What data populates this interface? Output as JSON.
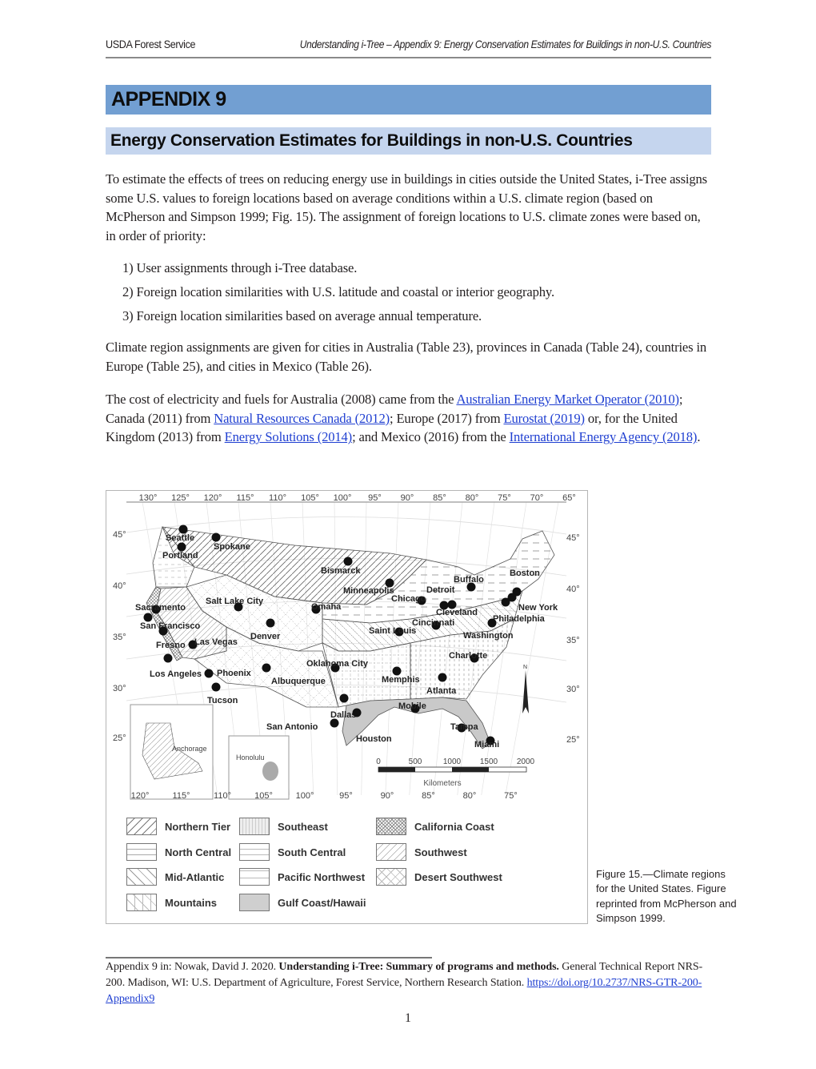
{
  "header": {
    "left": "USDA Forest Service",
    "right": "Understanding i-Tree – Appendix 9: Energy Conservation Estimates for Buildings in non-U.S. Countries"
  },
  "title": "APPENDIX 9",
  "subtitle": "Energy Conservation Estimates for Buildings in non-U.S. Countries",
  "intro_paragraph": "To estimate the effects of trees on reducing energy use in buildings in cities outside the United States, i-Tree assigns some U.S. values to foreign locations based on average conditions within a U.S. climate region (based on McPherson and Simpson 1999; Fig. 15). The assignment of foreign locations to U.S. climate zones were based on, in order of priority:",
  "priority_list": [
    "1) User assignments through i-Tree database.",
    "2) Foreign location similarities with U.S. latitude and coastal or interior geography.",
    "3) Foreign location similarities based on average annual temperature."
  ],
  "assignments_paragraph": "Climate region assignments are given for cities in Australia (Table 23), provinces in Canada (Table 24), countries in Europe (Table 25), and cities in Mexico (Table 26).",
  "cost_paragraph": {
    "t1": "The cost of electricity and fuels for Australia (2008) came from the ",
    "link1": "Australian Energy Market Operator (2010)",
    "t2": "; Canada (2011) from ",
    "link2": "Natural Resources Canada (2012)",
    "t3": "; Europe (2017) from ",
    "link3": "Eurostat (2019)",
    "t4": " or, for the United Kingdom (2013) from ",
    "link4": "Energy Solutions (2014)",
    "t5": "; and Mexico (2016) from the ",
    "link5": "International Energy Agency (2018)",
    "t6": "."
  },
  "figure": {
    "top_longitudes": [
      "130°",
      "125°",
      "120°",
      "115°",
      "110°",
      "105°",
      "100°",
      "95°",
      "90°",
      "85°",
      "80°",
      "75°",
      "70°",
      "65°"
    ],
    "bottom_longitudes": [
      "120°",
      "115°",
      "110°",
      "105°",
      "100°",
      "95°",
      "90°",
      "85°",
      "80°",
      "75°"
    ],
    "left_latitudes": [
      "45°",
      "40°",
      "35°",
      "30°",
      "25°"
    ],
    "right_latitudes": [
      "45°",
      "40°",
      "35°",
      "30°",
      "25°"
    ],
    "cities": [
      {
        "name": "Seattle"
      },
      {
        "name": "Spokane"
      },
      {
        "name": "Portland"
      },
      {
        "name": "Bismarck"
      },
      {
        "name": "Minneapolis"
      },
      {
        "name": "Buffalo"
      },
      {
        "name": "Boston"
      },
      {
        "name": "Detroit"
      },
      {
        "name": "Chicago"
      },
      {
        "name": "Sacramento"
      },
      {
        "name": "Salt Lake City"
      },
      {
        "name": "Omaha"
      },
      {
        "name": "Cleveland"
      },
      {
        "name": "New York"
      },
      {
        "name": "Philadelphia"
      },
      {
        "name": "San Francisco"
      },
      {
        "name": "Cincinnati"
      },
      {
        "name": "Saint Louis"
      },
      {
        "name": "Washington"
      },
      {
        "name": "Fresno"
      },
      {
        "name": "Las Vegas"
      },
      {
        "name": "Denver"
      },
      {
        "name": "Charlotte"
      },
      {
        "name": "Oklahoma City"
      },
      {
        "name": "Los Angeles"
      },
      {
        "name": "Phoenix"
      },
      {
        "name": "Albuquerque"
      },
      {
        "name": "Memphis"
      },
      {
        "name": "Atlanta"
      },
      {
        "name": "Tucson"
      },
      {
        "name": "Dallas"
      },
      {
        "name": "Mobile"
      },
      {
        "name": "San Antonio"
      },
      {
        "name": "Houston"
      },
      {
        "name": "Tampa"
      },
      {
        "name": "Miami"
      }
    ],
    "insets": {
      "alaska": "Anchorage",
      "hawaii": "Honolulu"
    },
    "scale_bar": {
      "ticks": [
        "0",
        "500",
        "1000",
        "1500",
        "2000"
      ],
      "unit": "Kilometers"
    },
    "north_label": "N",
    "legend": [
      {
        "label": "Northern Tier",
        "pattern": "diagonal-right"
      },
      {
        "label": "Southeast",
        "pattern": "dots-vertical"
      },
      {
        "label": "California Coast",
        "pattern": "crosshatch"
      },
      {
        "label": "North Central",
        "pattern": "dash-horizontal"
      },
      {
        "label": "South Central",
        "pattern": "grid-dashed"
      },
      {
        "label": "Southwest",
        "pattern": "diagonal-light"
      },
      {
        "label": "Mid-Atlantic",
        "pattern": "diagonal-left"
      },
      {
        "label": "Pacific Northwest",
        "pattern": "dash-fine"
      },
      {
        "label": "Desert Southwest",
        "pattern": "x-dashed"
      },
      {
        "label": "Mountains",
        "pattern": "star-dashed"
      },
      {
        "label": "Gulf Coast/Hawaii",
        "pattern": "solid-gray"
      }
    ]
  },
  "caption": "Figure 15.—Climate regions for the United States. Figure reprinted from McPherson and Simpson 1999.",
  "footnote": {
    "t1": "Appendix 9 in: Nowak, David J. 2020. ",
    "bold": "Understanding i-Tree: Summary of programs and methods.",
    "t2": " General Technical Report NRS-200. Madison, WI: U.S. Department of Agriculture, Forest Service, Northern Research Station. ",
    "link": "https://doi.org/10.2737/NRS-GTR-200-Appendix9"
  },
  "page_number": "1",
  "colors": {
    "title_bar": "#729fd2",
    "subtitle_bar": "#c5d5ee",
    "link": "#1f3fd1",
    "gulf_fill": "#c9c9c9"
  }
}
